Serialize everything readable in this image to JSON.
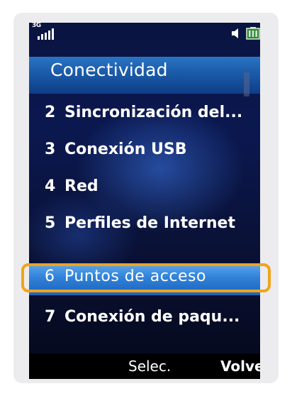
{
  "status_bar": {
    "network": "3G",
    "signal_icon": "signal-bars-icon",
    "speaker_icon": "speaker-icon",
    "battery_icon": "battery-icon"
  },
  "header": {
    "title": "Conectividad"
  },
  "menu": {
    "items": [
      {
        "number": "2",
        "label": "Sincronización del..."
      },
      {
        "number": "3",
        "label": "Conexión USB"
      },
      {
        "number": "4",
        "label": "Red"
      },
      {
        "number": "5",
        "label": "Perfiles de Internet"
      },
      {
        "number": "6",
        "label": "Puntos de acceso",
        "selected": true
      },
      {
        "number": "7",
        "label": "Conexión de paqu..."
      }
    ]
  },
  "softkeys": {
    "center": "Selec.",
    "right": "Volver"
  },
  "colors": {
    "title_bar": "#1a5aa8",
    "selection": "#2f80d6",
    "highlight_ring": "#f0a418",
    "background": "#0b1850"
  }
}
